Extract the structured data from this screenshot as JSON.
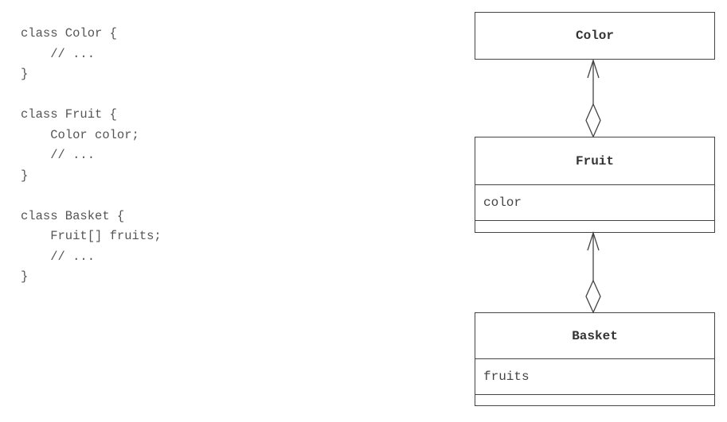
{
  "code": {
    "lines": [
      "class Color {",
      "    // ...",
      "}",
      "",
      "class Fruit {",
      "    Color color;",
      "    // ...",
      "}",
      "",
      "class Basket {",
      "    Fruit[] fruits;",
      "    // ...",
      "}"
    ]
  },
  "diagram": {
    "classes": [
      {
        "name": "Color",
        "attributes": []
      },
      {
        "name": "Fruit",
        "attributes": [
          "color"
        ]
      },
      {
        "name": "Basket",
        "attributes": [
          "fruits"
        ]
      }
    ],
    "relations": [
      {
        "from": "Fruit",
        "to": "Color",
        "kind": "aggregation"
      },
      {
        "from": "Basket",
        "to": "Fruit",
        "kind": "aggregation"
      }
    ]
  }
}
